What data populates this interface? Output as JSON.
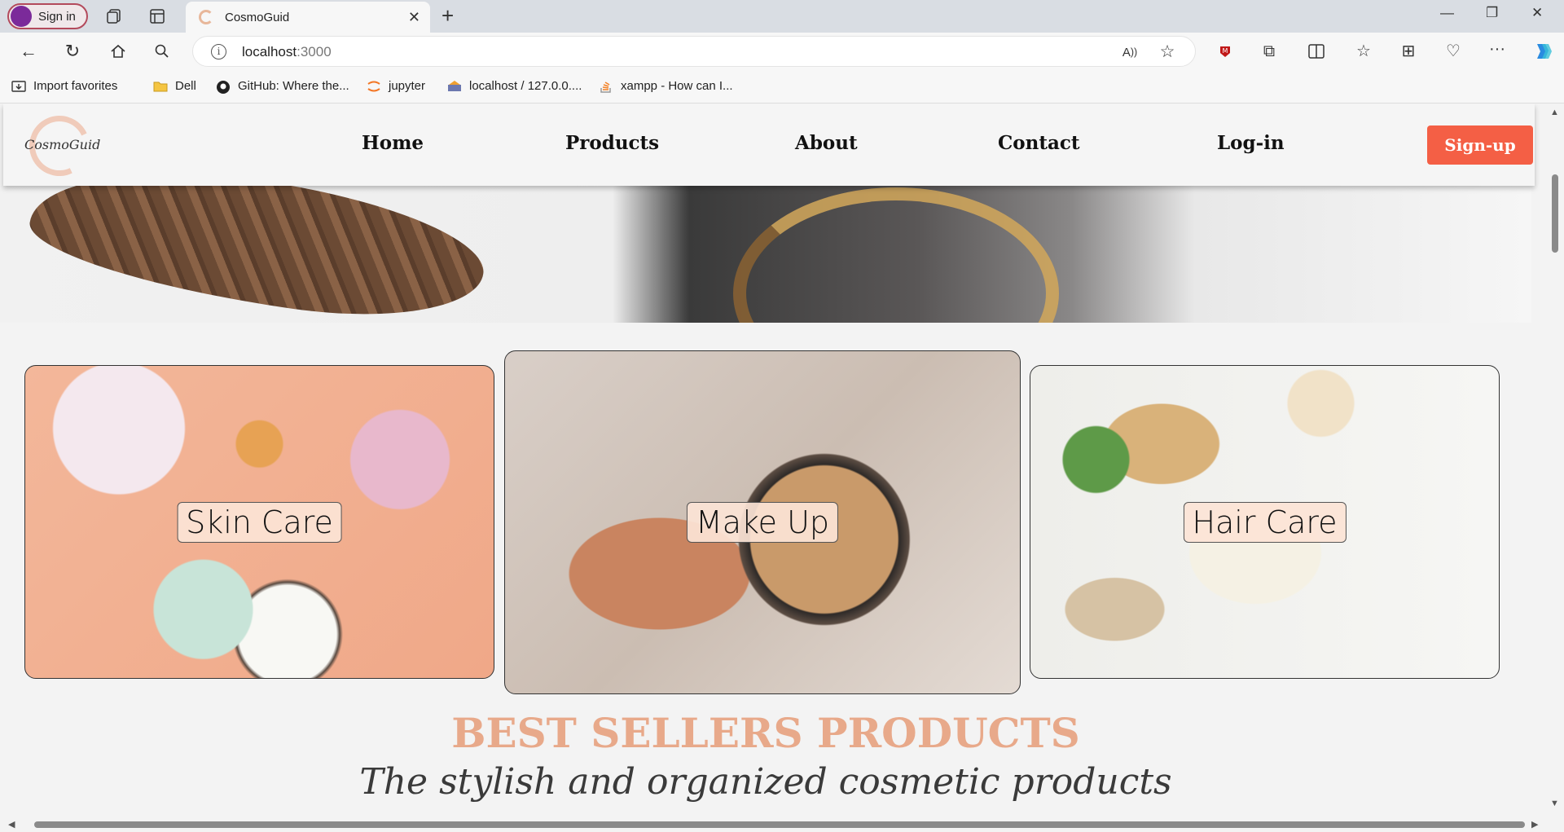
{
  "browser": {
    "signin_label": "Sign in",
    "tab_title": "CosmoGuid",
    "url_host": "localhost",
    "url_port": ":3000",
    "favorites": [
      {
        "label": "Import favorites"
      },
      {
        "label": "Dell"
      },
      {
        "label": "GitHub: Where the..."
      },
      {
        "label": "jupyter"
      },
      {
        "label": "localhost / 127.0.0...."
      },
      {
        "label": "xampp - How can I..."
      }
    ]
  },
  "site": {
    "logo_text": "CosmoGuid",
    "nav": [
      "Home",
      "Products",
      "About",
      "Contact",
      "Log-in"
    ],
    "signup_label": "Sign-up",
    "accent_color": "#f45f45",
    "categories": [
      "Skin Care",
      "Make Up",
      "Hair Care"
    ],
    "best_title": "BEST SELLERS PRODUCTS",
    "tagline": "The stylish and organized cosmetic products"
  }
}
